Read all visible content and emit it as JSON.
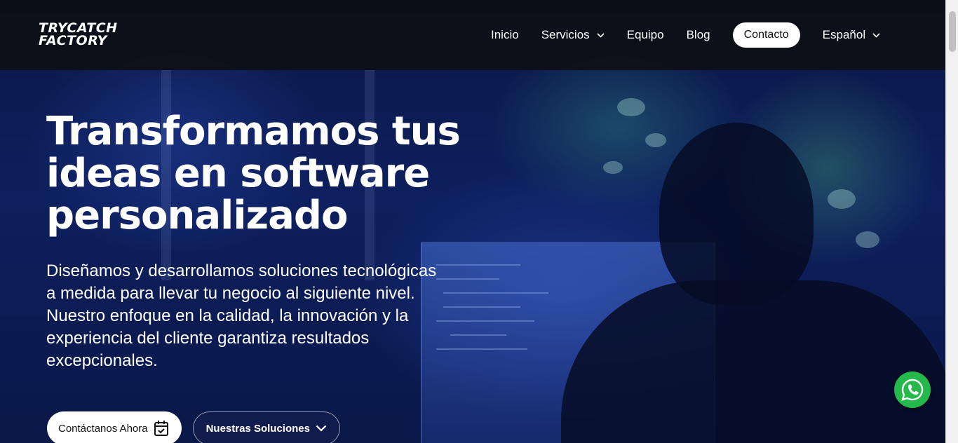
{
  "logo": {
    "line1": "TRYCATCH",
    "line2": "FACTORY"
  },
  "nav": {
    "items": [
      {
        "label": "Inicio",
        "has_dropdown": false
      },
      {
        "label": "Servicios",
        "has_dropdown": true
      },
      {
        "label": "Equipo",
        "has_dropdown": false
      },
      {
        "label": "Blog",
        "has_dropdown": false
      }
    ],
    "contact_label": "Contacto",
    "language_label": "Español"
  },
  "hero": {
    "title": "Transformamos tus ideas en software personalizado",
    "subtitle": "Diseñamos y desarrollamos soluciones tecnológicas a medida para llevar tu negocio al siguiente nivel. Nuestro enfoque en la calidad, la innovación y la experiencia del cliente garantiza resultados excepcionales.",
    "cta_primary": "Contáctanos Ahora",
    "cta_secondary": "Nuestras Soluciones"
  },
  "icons": {
    "primary_cta": "calendar-check-icon",
    "secondary_cta": "chevron-down-icon",
    "floating": "whatsapp-icon"
  },
  "colors": {
    "header_bg": "#0e0e12",
    "hero_bg": "#0d1f5e",
    "whatsapp": "#25b84a"
  }
}
